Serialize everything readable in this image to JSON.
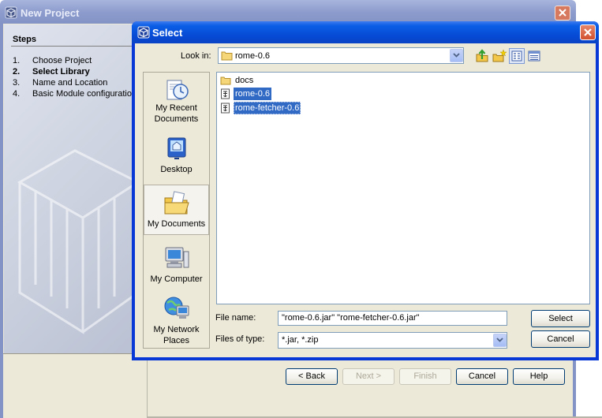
{
  "new_project": {
    "title": "New Project",
    "steps_title": "Steps",
    "steps": [
      {
        "num": "1.",
        "label": "Choose Project",
        "current": false
      },
      {
        "num": "2.",
        "label": "Select Library",
        "current": true
      },
      {
        "num": "3.",
        "label": "Name and Location",
        "current": false
      },
      {
        "num": "4.",
        "label": "Basic Module configuration",
        "current": false
      }
    ],
    "buttons": {
      "back": "< Back",
      "next": "Next >",
      "finish": "Finish",
      "cancel": "Cancel",
      "help": "Help"
    }
  },
  "select_dialog": {
    "title": "Select",
    "look_in_label": "Look in:",
    "look_in_value": "rome-0.6",
    "places": [
      {
        "label": "My Recent Documents",
        "icon": "recent-documents-icon",
        "active": false
      },
      {
        "label": "Desktop",
        "icon": "desktop-icon",
        "active": false
      },
      {
        "label": "My Documents",
        "icon": "my-documents-icon",
        "active": true
      },
      {
        "label": "My Computer",
        "icon": "my-computer-icon",
        "active": false
      },
      {
        "label": "My Network Places",
        "icon": "network-places-icon",
        "active": false
      }
    ],
    "files": [
      {
        "name": "docs",
        "type": "folder",
        "selected": false
      },
      {
        "name": "rome-0.6",
        "type": "jar",
        "selected": true
      },
      {
        "name": "rome-fetcher-0.6",
        "type": "jar",
        "selected": true
      }
    ],
    "file_name_label": "File name:",
    "file_name_value": "\"rome-0.6.jar\" \"rome-fetcher-0.6.jar\"",
    "files_of_type_label": "Files of type:",
    "files_of_type_value": "*.jar, *.zip",
    "select_button": "Select",
    "cancel_button": "Cancel",
    "toolbar_icons": [
      "up-folder-icon",
      "new-folder-icon",
      "list-view-icon",
      "details-view-icon"
    ]
  },
  "colors": {
    "xp_title_blue": "#0b5ee6",
    "selection": "#316ac5",
    "dialog_face": "#ece9d8"
  }
}
